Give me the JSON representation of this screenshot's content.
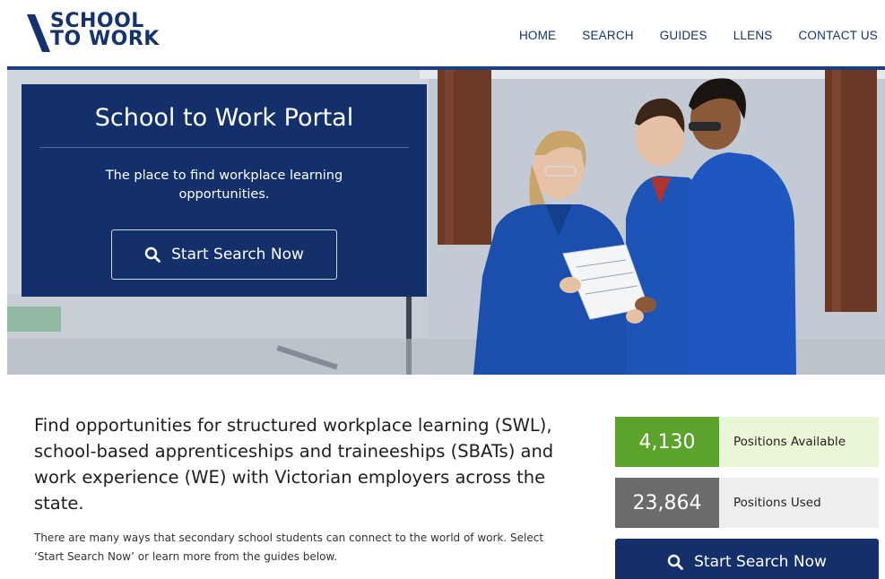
{
  "logo": {
    "line1": "SCHOOL",
    "line2": "TO WORK",
    "color": "#14326b"
  },
  "nav": {
    "items": [
      {
        "label": "HOME"
      },
      {
        "label": "SEARCH"
      },
      {
        "label": "GUIDES"
      },
      {
        "label": "LLENS"
      },
      {
        "label": "CONTACT US"
      }
    ]
  },
  "hero": {
    "title": "School to Work Portal",
    "subtitle": "The place to find workplace learning opportunities.",
    "button_label": "Start Search Now",
    "button_icon": "search-icon",
    "image_description": "three-people-in-blue-overalls-reviewing-document"
  },
  "main": {
    "lead": "Find opportunities for structured workplace learning (SWL), school-based apprenticeships and traineeships (SBATs) and work experience (WE) with Victorian employers across the state.",
    "body": "There are many ways that secondary school students can connect to the world of work. Select ‘Start Search Now’ or learn more from the guides below."
  },
  "stats": {
    "available": {
      "value": "4,130",
      "label": "Positions Available",
      "color": "#5ba32b"
    },
    "used": {
      "value": "23,864",
      "label": "Positions Used",
      "color": "#6b6b6b"
    }
  },
  "search_button": {
    "label": "Start Search Now",
    "icon": "search-icon"
  },
  "colors": {
    "brand_navy": "#13306a",
    "header_rule": "#1c3f7d"
  }
}
